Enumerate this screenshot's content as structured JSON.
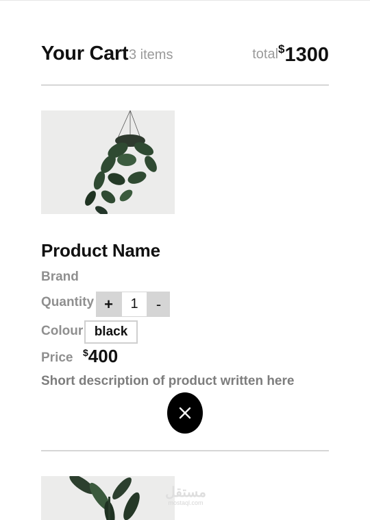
{
  "cart": {
    "title": "Your Cart",
    "item_count": "3 items",
    "total_label": "total",
    "total_currency": "$",
    "total_value": "1300"
  },
  "product": {
    "name": "Product Name",
    "brand_label": "Brand",
    "quantity_label": "Quantity",
    "quantity_increment": "+",
    "quantity_value": "1",
    "quantity_decrement": "-",
    "colour_label": "Colour",
    "colour_value": "black",
    "price_label": "Price",
    "price_currency": "$",
    "price_value": "400",
    "description": "Short description of product written here",
    "image_icon": "hanging-plant-image",
    "remove_icon": "close-icon"
  },
  "next_product": {
    "image_icon": "potted-plant-image"
  },
  "watermark": {
    "text": "مستقل",
    "subtext": "mostaql.com"
  },
  "colors": {
    "text": "#111111",
    "muted": "#8f8f8f",
    "divider": "#d6d6d6",
    "stepper_bg": "#d5d5d5",
    "remove_button_bg": "#000000"
  }
}
